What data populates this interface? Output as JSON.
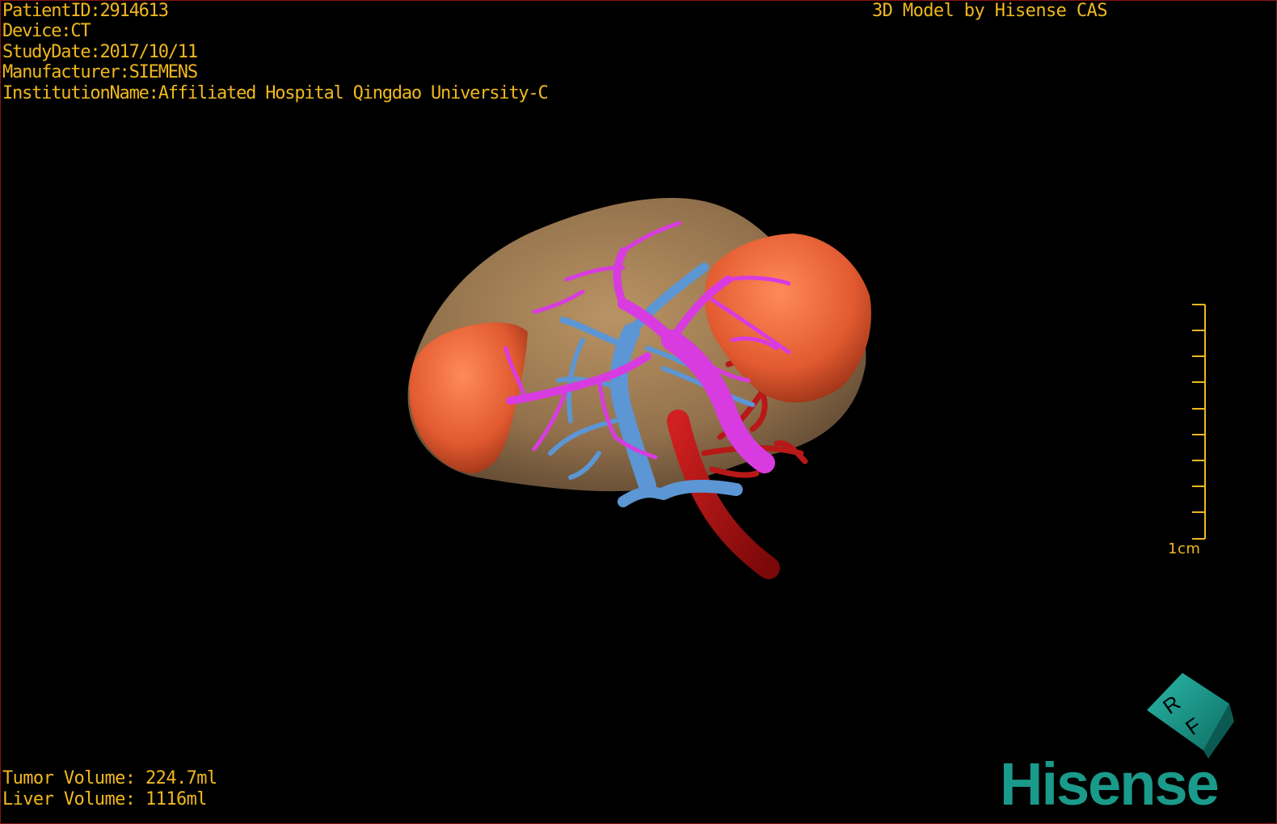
{
  "dicom_info": {
    "patient_id": "PatientID:2914613",
    "device": "Device:CT",
    "study_date": "StudyDate:2017/10/11",
    "manufacturer": "Manufacturer:SIEMENS",
    "institution": "InstitutionName:Affiliated Hospital Qingdao University-C"
  },
  "credit": "3D Model by Hisense CAS",
  "volumes": {
    "tumor": "Tumor Volume: 224.7ml",
    "liver": "Liver Volume: 1116ml"
  },
  "scale_bar": {
    "label": "1cm"
  },
  "orientation_cube": {
    "face_letters": [
      "R",
      "F"
    ]
  },
  "brand": "Hisense",
  "colors": {
    "overlay_text": "#f0b81e",
    "liver": "#b08a5c",
    "tumor": "#e8623a",
    "portal_vein": "#d83ce0",
    "hepatic_vein": "#5c96d4",
    "artery": "#b81818",
    "brand": "#1a9a8a",
    "frame": "#8a1414"
  },
  "icons": {
    "orientation": "orientation-cube-icon",
    "logo": "hisense-logo"
  }
}
